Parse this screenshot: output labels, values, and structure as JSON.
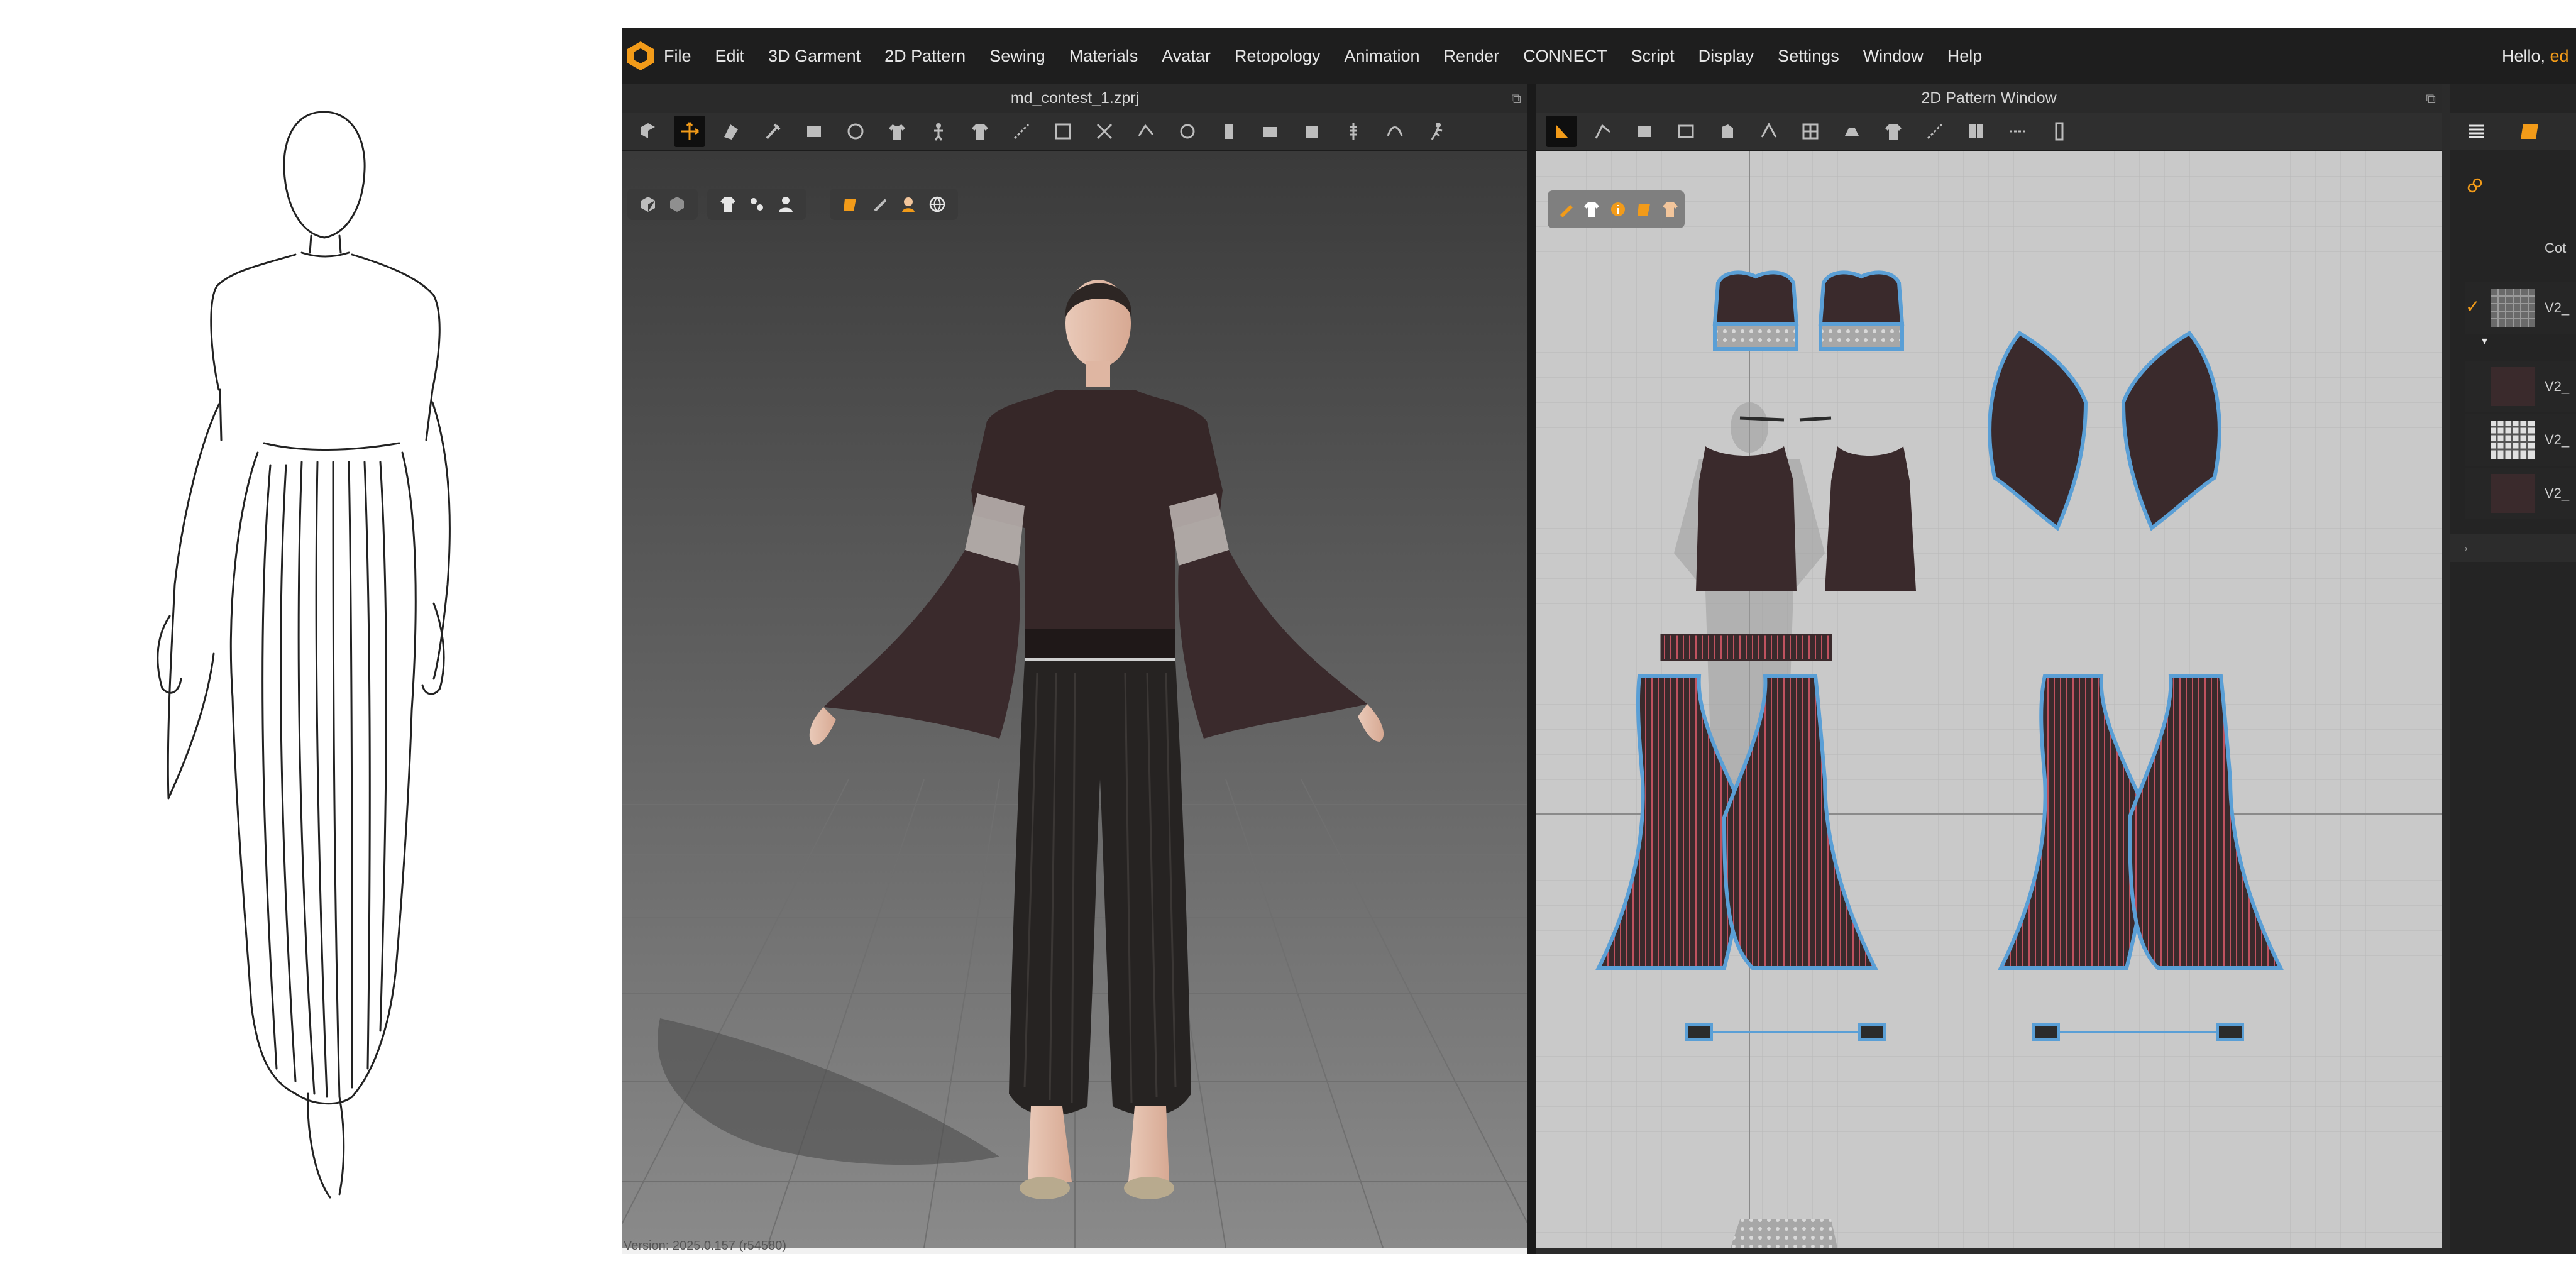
{
  "menu": {
    "items": [
      "File",
      "Edit",
      "3D Garment",
      "2D Pattern",
      "Sewing",
      "Materials",
      "Avatar",
      "Retopology",
      "Animation",
      "Render",
      "CONNECT",
      "Script",
      "Display",
      "Settings",
      "Window",
      "Help"
    ],
    "greeting": "Hello, ",
    "user": "ed"
  },
  "viewport3d": {
    "file_title": "md_contest_1.zprj"
  },
  "pattern_window": {
    "title": "2D Pattern Window"
  },
  "object_browser": {
    "header": "Cot",
    "items": [
      "V2_",
      "V2_",
      "V2_",
      "V2_"
    ]
  },
  "status": {
    "version": "Version: 2025.0.157 (r54580)"
  },
  "colors": {
    "accent": "#f29b19",
    "fabric": "#3a2a2c",
    "selection": "#5a9fd6",
    "rib": "#c0525f"
  }
}
